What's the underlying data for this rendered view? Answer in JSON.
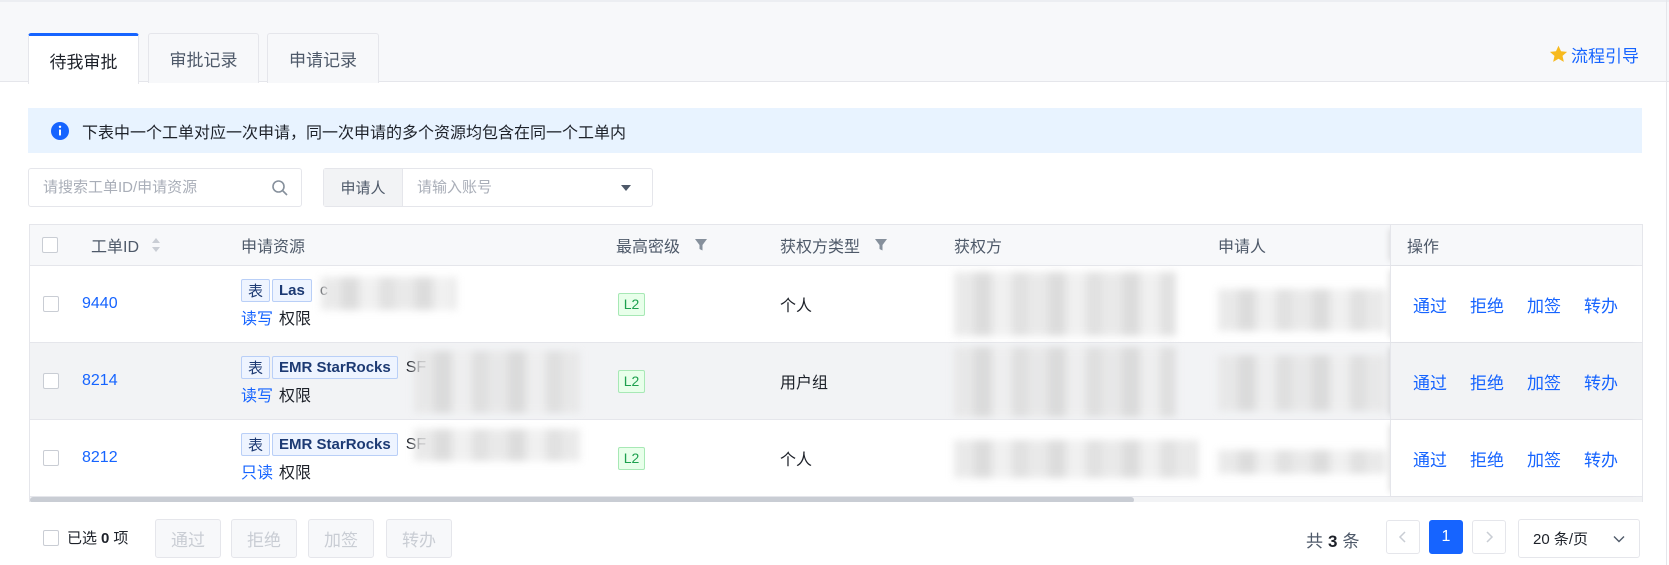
{
  "colors": {
    "accent": "#1664ff",
    "star": "#f7ba1e",
    "banner_bg": "#e8f3ff",
    "level_green": "#1da04e",
    "hover_row": "#f2f3f5"
  },
  "tabs": [
    {
      "label": "待我审批",
      "active": true
    },
    {
      "label": "审批记录",
      "active": false
    },
    {
      "label": "申请记录",
      "active": false
    }
  ],
  "guide_link": {
    "label": "流程引导",
    "icon": "star-icon"
  },
  "banner": {
    "icon": "info-icon",
    "text": "下表中一个工单对应一次申请，同一次申请的多个资源均包含在同一个工单内"
  },
  "search": {
    "placeholder": "请搜索工单ID/申请资源",
    "value": "",
    "icon": "search-icon"
  },
  "applicant_filter": {
    "label": "申请人",
    "placeholder": "请输入账号",
    "value": "",
    "icon": "caret-down-icon"
  },
  "table": {
    "columns": {
      "id": "工单ID",
      "resource": "申请资源",
      "level": "最高密级",
      "grantee_type": "获权方类型",
      "grantee": "获权方",
      "applicant": "申请人",
      "actions": "操作"
    },
    "rows": [
      {
        "id": "9440",
        "resource_type": "表",
        "resource_source": "Las",
        "resource_name": "c",
        "permission": "读写",
        "permission_suffix": "权限",
        "level": "L2",
        "grantee_type": "个人",
        "selected": false
      },
      {
        "id": "8214",
        "resource_type": "表",
        "resource_source": "EMR StarRocks",
        "resource_name": "SF",
        "permission": "读写",
        "permission_suffix": "权限",
        "level": "L2",
        "grantee_type": "用户组",
        "selected": false
      },
      {
        "id": "8212",
        "resource_type": "表",
        "resource_source": "EMR StarRocks",
        "resource_name": "SF",
        "permission": "只读",
        "permission_suffix": "权限",
        "level": "L2",
        "grantee_type": "个人",
        "selected": false
      }
    ],
    "row_actions": [
      "通过",
      "拒绝",
      "加签",
      "转办"
    ],
    "horizontal_scroll_visible_fraction": 0.68
  },
  "footer": {
    "selected_prefix": "已选",
    "selected_count": "0",
    "selected_suffix": "项",
    "bulk_actions": [
      "通过",
      "拒绝",
      "加签",
      "转办"
    ],
    "total_prefix": "共",
    "total_count": "3",
    "total_suffix": "条",
    "current_page": "1",
    "page_size": "20 条/页"
  }
}
